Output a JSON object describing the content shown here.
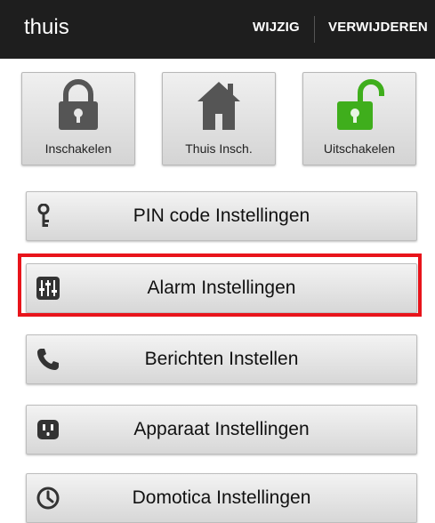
{
  "appbar": {
    "title": "thuis",
    "edit_label": "WIJZIG",
    "delete_label": "VERWIJDEREN"
  },
  "modes": [
    {
      "label": "Inschakelen",
      "icon": "lock-closed-icon",
      "color": "#555555"
    },
    {
      "label": "Thuis Insch.",
      "icon": "home-icon",
      "color": "#555555"
    },
    {
      "label": "Uitschakelen",
      "icon": "lock-open-icon",
      "color": "#3fae1c"
    }
  ],
  "menu": [
    {
      "label": "PIN code Instellingen",
      "icon": "key-icon"
    },
    {
      "label": "Alarm Instellingen",
      "icon": "sliders-icon"
    },
    {
      "label": "Berichten Instellen",
      "icon": "phone-icon"
    },
    {
      "label": "Apparaat Instellingen",
      "icon": "power-outlet-icon"
    },
    {
      "label": "Domotica Instellingen",
      "icon": "clock-icon"
    }
  ],
  "highlight_color": "#e8141b"
}
